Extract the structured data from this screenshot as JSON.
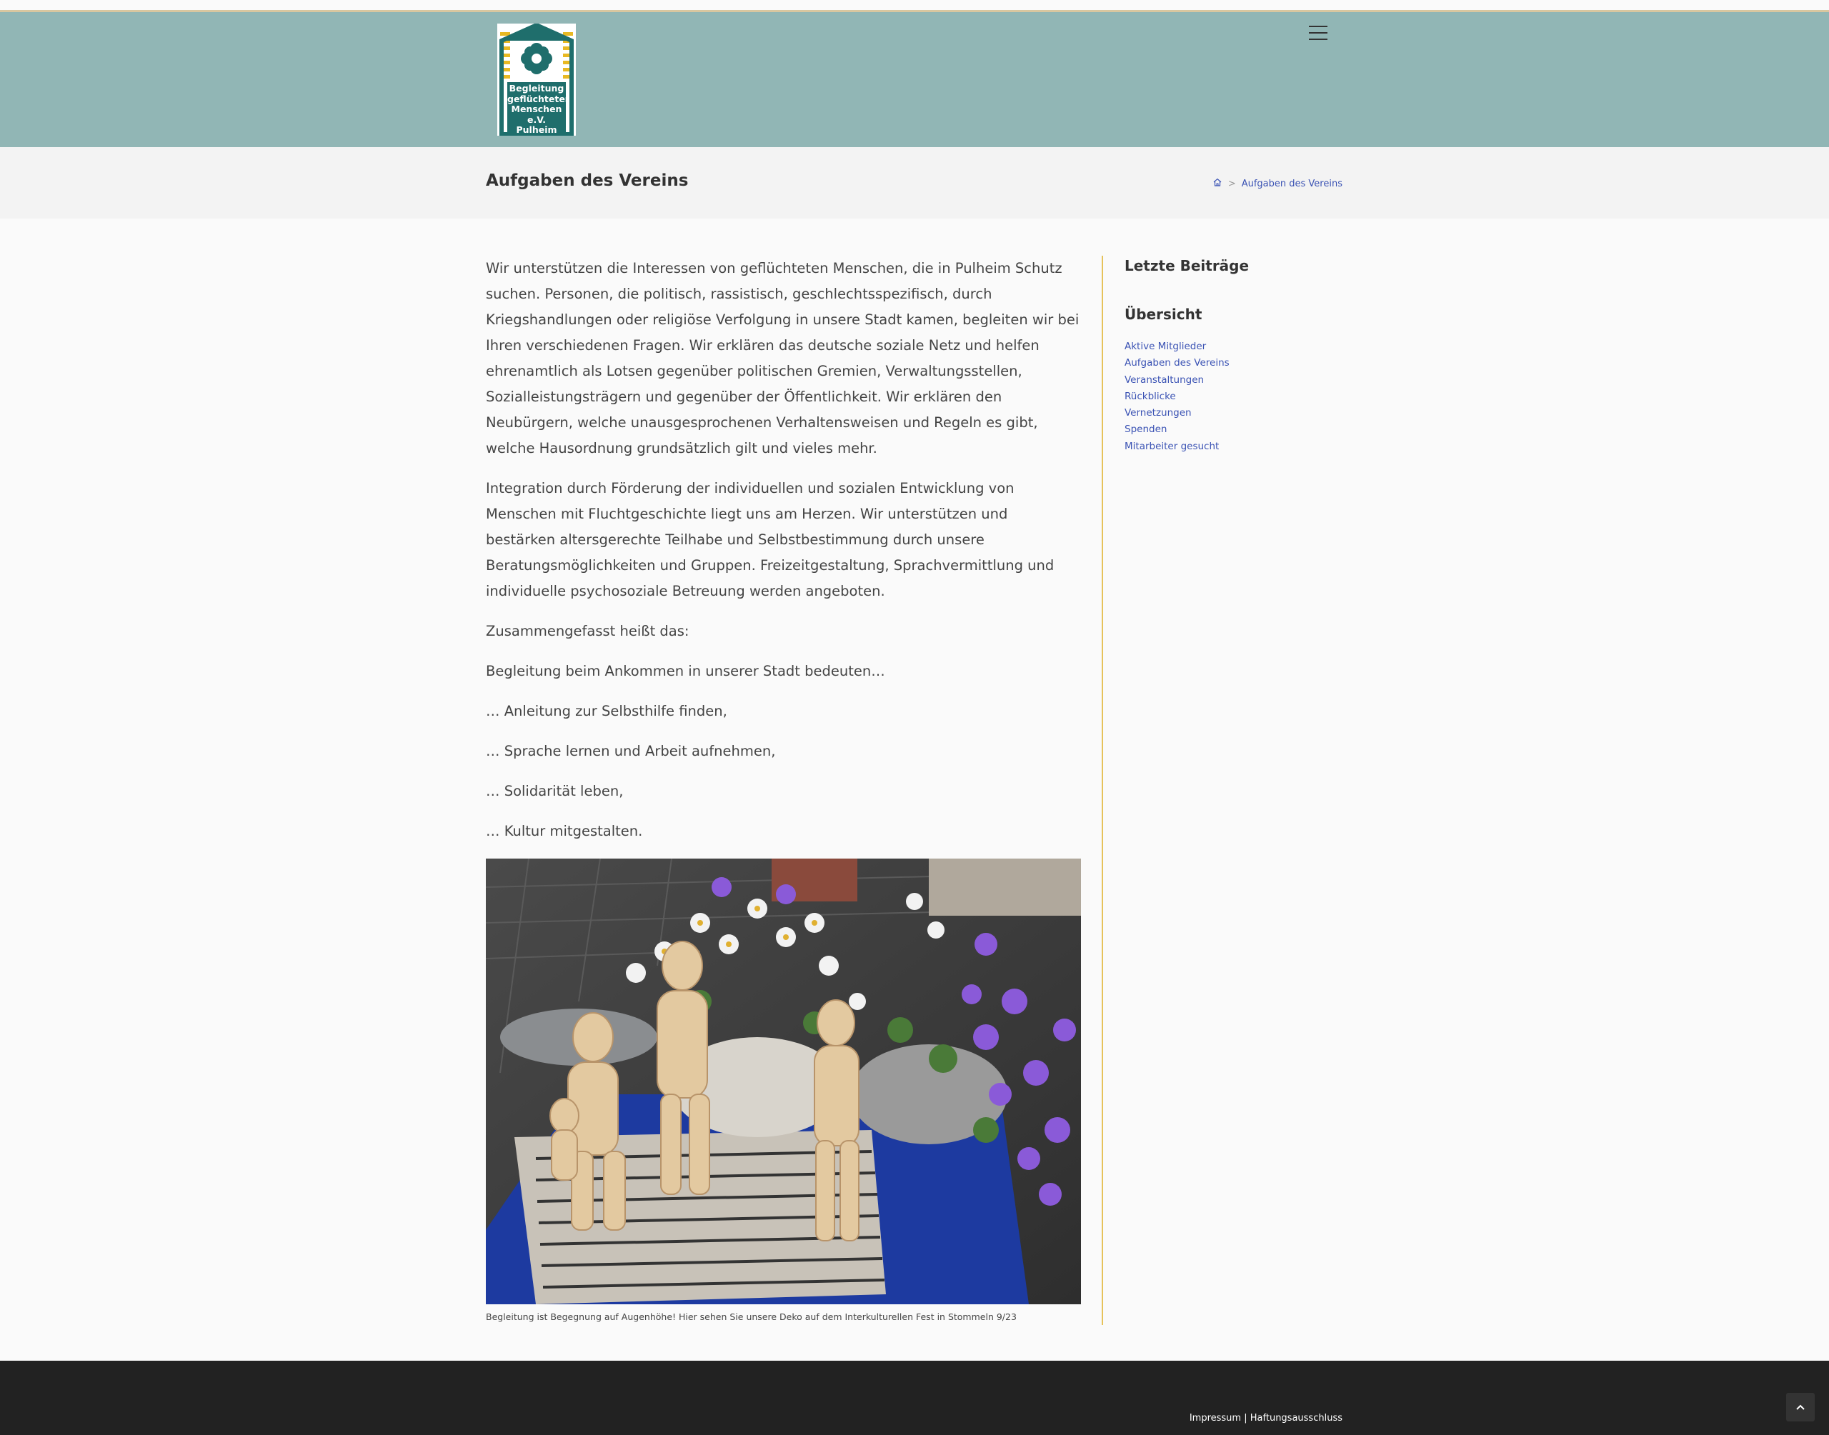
{
  "header": {
    "logo_lines": [
      "Begleitung",
      "geflüchteter",
      "Menschen",
      "e.V.",
      "Pulheim"
    ],
    "menu_icon": "hamburger-menu-icon"
  },
  "page": {
    "title": "Aufgaben des Vereins",
    "breadcrumb": {
      "home_icon": "home-icon",
      "separator": ">",
      "current": "Aufgaben des Vereins"
    }
  },
  "content": {
    "paragraphs": [
      "Wir unterstützen die Interessen von geflüchteten Menschen, die in Pulheim Schutz suchen. Personen, die politisch, rassistisch, geschlechtsspezifisch, durch Kriegshandlungen oder religiöse Verfolgung in unsere Stadt kamen, begleiten wir bei Ihren verschiedenen Fragen. Wir erklären das deutsche soziale Netz und helfen ehrenamtlich als Lotsen gegenüber politischen Gremien, Verwaltungsstellen, Sozialleistungsträgern und gegenüber der Öffentlichkeit. Wir erklären den Neubürgern, welche unausgesprochenen Verhaltensweisen und Regeln es gibt, welche Hausordnung grundsätzlich gilt und vieles mehr.",
      "Integration durch Förderung der individuellen und sozialen Entwicklung von Menschen mit Fluchtgeschichte liegt uns am Herzen. Wir unterstützen und bestärken altersgerechte Teilhabe und Selbstbestimmung durch unsere Beratungsmöglichkeiten und Gruppen. Freizeitgestaltung, Sprachvermittlung und individuelle psychosoziale Betreuung werden angeboten.",
      "Zusammengefasst heißt das:",
      "Begleitung beim Ankommen in unserer Stadt bedeuten…",
      "… Anleitung zur Selbsthilfe finden,",
      "… Sprache lernen und Arbeit aufnehmen,",
      "… Solidarität leben,",
      "… Kultur mitgestalten."
    ],
    "caption": "Begleitung ist Begegnung auf Augenhöhe! Hier sehen Sie unsere Deko auf dem Interkulturellen Fest in Stommeln 9/23"
  },
  "sidebar": {
    "recent_title": "Letzte Beiträge",
    "overview_title": "Übersicht",
    "links": [
      "Aktive Mitglieder",
      "Aufgaben des Vereins",
      "Veranstaltungen",
      "Rückblicke",
      "Vernetzungen",
      "Spenden",
      "Mitarbeiter gesucht"
    ]
  },
  "footer": {
    "impressum": "Impressum",
    "separator": "|",
    "haftung": "Haftungsausschluss",
    "scroll_top_icon": "chevron-up-icon"
  },
  "colors": {
    "header_bg": "#91b6b5",
    "accent_line": "#e6c25a",
    "link": "#3b53b4",
    "footer_bg": "#222222",
    "logo_green": "#1f6e6c",
    "logo_yellow": "#e8b923"
  }
}
